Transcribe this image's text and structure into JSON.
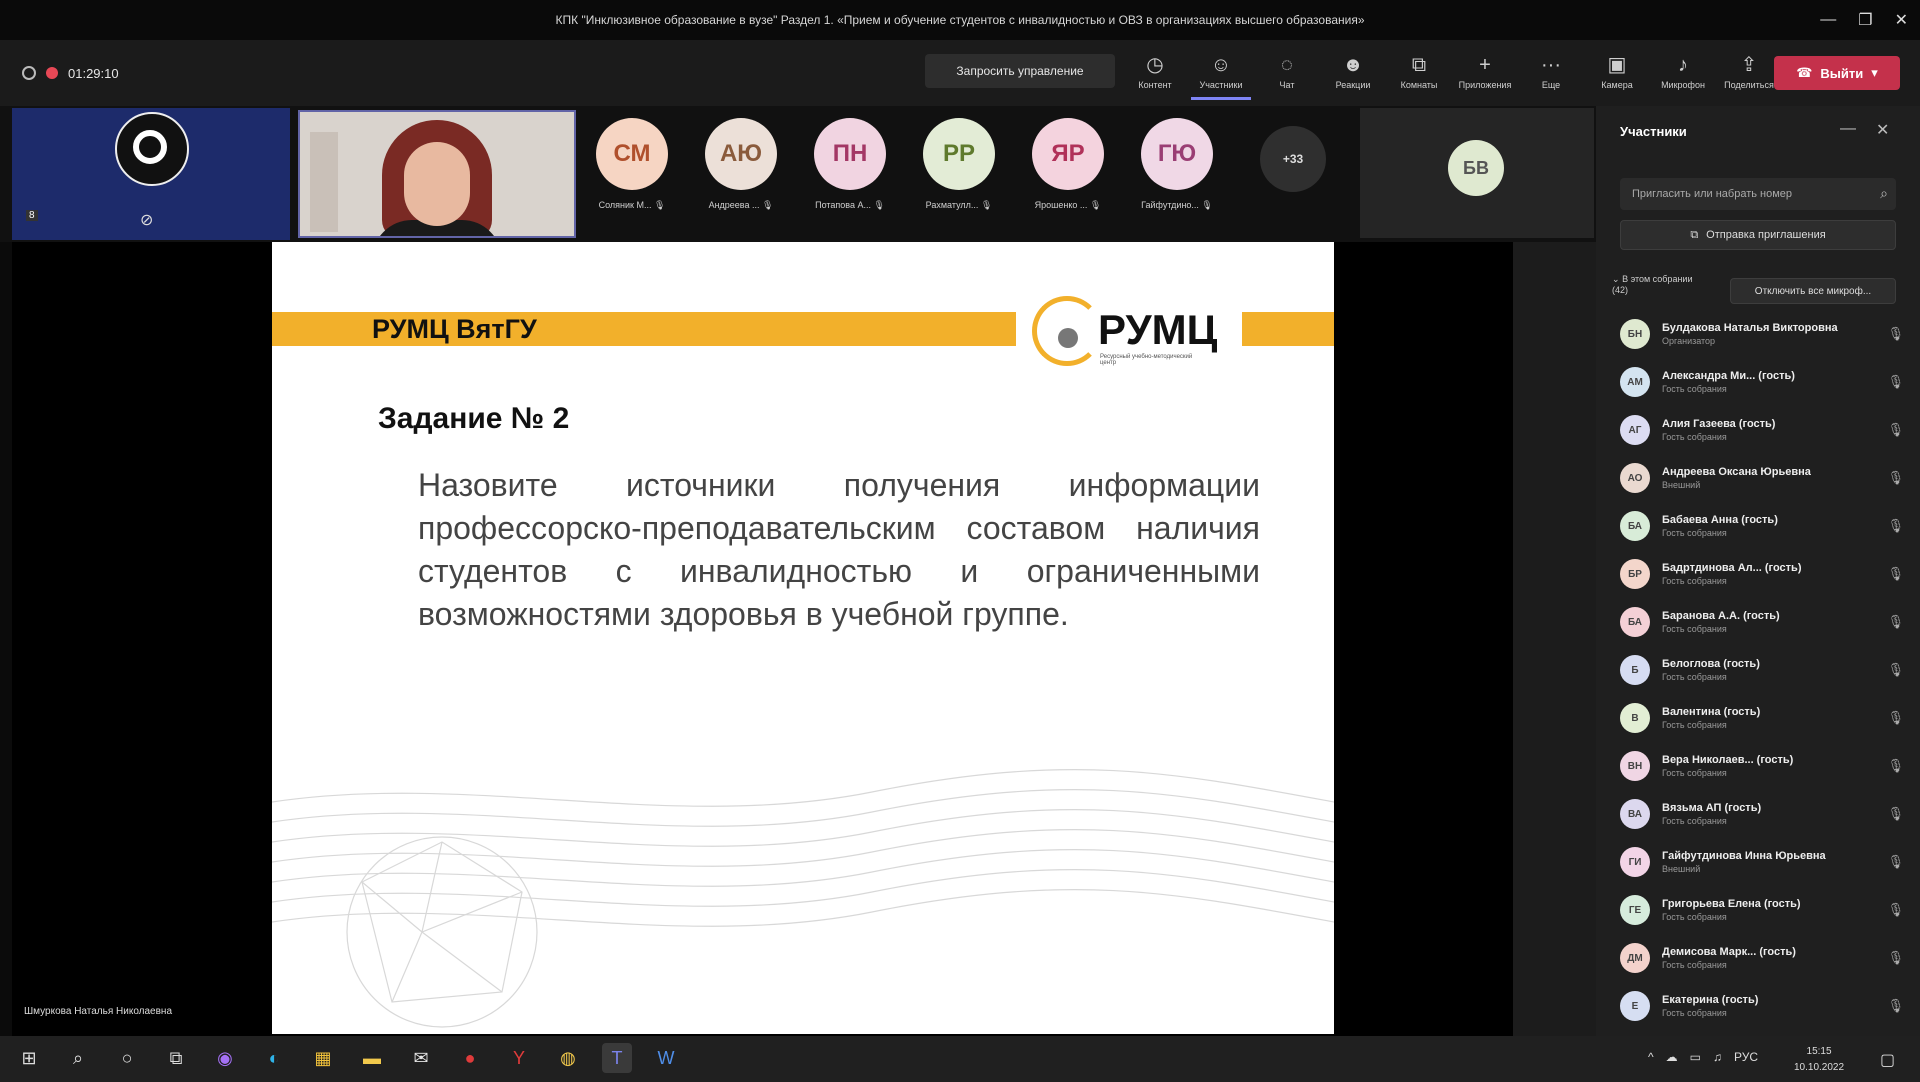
{
  "window": {
    "title": "КПК \"Инклюзивное образование в вузе\" Раздел 1. «Прием и обучение студентов с инвалидностью и ОВЗ в организациях высшего образования»",
    "controls": [
      "—",
      "❐",
      "✕"
    ]
  },
  "toolbar": {
    "timer": "01:29:10",
    "request_control": "Запросить управление",
    "buttons": [
      {
        "label": "Контент",
        "icon": "◷"
      },
      {
        "label": "Участники",
        "icon": "☺"
      },
      {
        "label": "Чат",
        "icon": "◌"
      },
      {
        "label": "Реакции",
        "icon": "☻"
      },
      {
        "label": "Комнаты",
        "icon": "⧉"
      },
      {
        "label": "Приложения",
        "icon": "+"
      },
      {
        "label": "Еще",
        "icon": "···"
      },
      {
        "label": "Камера",
        "icon": "▣"
      },
      {
        "label": "Микрофон",
        "icon": "♪"
      },
      {
        "label": "Поделиться",
        "icon": "⇪"
      }
    ],
    "leave_label": "Выйти",
    "leave_icon": "☎"
  },
  "strip": {
    "mini_badge": "8",
    "avatars": [
      {
        "initials": "СМ",
        "name": "Соляник М... 🎙",
        "bg": "#f6d5c3",
        "fg": "#b0502c"
      },
      {
        "initials": "АЮ",
        "name": "Андреева ... 🎙",
        "bg": "#ece0d8",
        "fg": "#8a5b3c"
      },
      {
        "initials": "ПН",
        "name": "Потапова А... 🎙",
        "bg": "#f1d4e1",
        "fg": "#a33765"
      },
      {
        "initials": "РР",
        "name": "Рахматулл... 🎙",
        "bg": "#e3ecd6",
        "fg": "#5f7a2d"
      },
      {
        "initials": "ЯР",
        "name": "Ярошенко ... 🎙",
        "bg": "#f4d3de",
        "fg": "#b03159"
      },
      {
        "initials": "ГЮ",
        "name": "Гайфутдино... 🎙",
        "bg": "#f0d8e6",
        "fg": "#9a3e74"
      }
    ],
    "more_count": "+33",
    "bv_initials": "БВ"
  },
  "slide": {
    "org": "РУМЦ ВятГУ",
    "logo_text": "РУМЦ",
    "logo_sub": "Ресурсный учебно-методический центр",
    "task_title": "Задание № 2",
    "task_body": "Назовите источники получения информации профессорско-преподавательским составом наличия студентов с инвалидностью и ограниченными возможностями здоровья в учебной группе."
  },
  "speaker_label": "Шмуркова Наталья Николаевна",
  "panel": {
    "title": "Участники",
    "invite_placeholder": "Пригласить или набрать номер",
    "share_invite": "Отправка приглашения",
    "section_label": "В этом собрании (42)",
    "mute_all": "Отключить все микроф...",
    "participants": [
      {
        "initials": "БН",
        "name": "Булдакова Наталья Викторовна",
        "role": "Организатор",
        "bg": "#dfe9d0"
      },
      {
        "initials": "АМ",
        "name": "Александра Ми... (гость)",
        "role": "Гость собрания",
        "bg": "#d4e4f0"
      },
      {
        "initials": "АГ",
        "name": "Алия Газеева (гость)",
        "role": "Гость собрания",
        "bg": "#dcdcf2"
      },
      {
        "initials": "АО",
        "name": "Андреева Оксана Юрьевна",
        "role": "Внешний",
        "bg": "#ead9d0"
      },
      {
        "initials": "БА",
        "name": "Бабаева Анна (гость)",
        "role": "Гость собрания",
        "bg": "#d8ecd8"
      },
      {
        "initials": "БР",
        "name": "Бадртдинова Ал... (гость)",
        "role": "Гость собрания",
        "bg": "#f3d6cb"
      },
      {
        "initials": "БА",
        "name": "Баранова А.А. (гость)",
        "role": "Гость собрания",
        "bg": "#f4d0d6"
      },
      {
        "initials": "Б",
        "name": "Белоглова (гость)",
        "role": "Гость собрания",
        "bg": "#d6dcf2"
      },
      {
        "initials": "В",
        "name": "Валентина (гость)",
        "role": "Гость собрания",
        "bg": "#e2eed4"
      },
      {
        "initials": "ВН",
        "name": "Вера Николаев... (гость)",
        "role": "Гость собрания",
        "bg": "#f0d6e4"
      },
      {
        "initials": "ВА",
        "name": "Вязьма АП (гость)",
        "role": "Гость собрания",
        "bg": "#dcd8ee"
      },
      {
        "initials": "ГИ",
        "name": "Гайфутдинова Инна Юрьевна",
        "role": "Внешний",
        "bg": "#f2d4e6"
      },
      {
        "initials": "ГЕ",
        "name": "Григорьева Елена (гость)",
        "role": "Гость собрания",
        "bg": "#d6ecdc"
      },
      {
        "initials": "ДМ",
        "name": "Демисова Марк... (гость)",
        "role": "Гость собрания",
        "bg": "#f3d2cc"
      },
      {
        "initials": "Е",
        "name": "Екатерина (гость)",
        "role": "Гость собрания",
        "bg": "#d6def2"
      }
    ]
  },
  "taskbar": {
    "icons": [
      {
        "name": "start",
        "glyph": "⊞"
      },
      {
        "name": "search",
        "glyph": "⌕"
      },
      {
        "name": "cortana",
        "glyph": "○"
      },
      {
        "name": "task-view",
        "glyph": "⧉"
      },
      {
        "name": "app-purple",
        "glyph": "◉",
        "color": "#a470f5"
      },
      {
        "name": "edge",
        "glyph": "◐",
        "color": "#2fb3e8"
      },
      {
        "name": "store",
        "glyph": "▦",
        "color": "#f0c13a"
      },
      {
        "name": "files",
        "glyph": "▬",
        "color": "#f2c94c"
      },
      {
        "name": "mail",
        "glyph": "✉",
        "color": "#e6e6e6"
      },
      {
        "name": "app-red",
        "glyph": "●",
        "color": "#e03b3b"
      },
      {
        "name": "yandex",
        "glyph": "Y",
        "color": "#e03b3b"
      },
      {
        "name": "chrome",
        "glyph": "◍",
        "color": "#f2c94c"
      },
      {
        "name": "teams",
        "glyph": "T",
        "color": "#7b83eb",
        "active": true
      },
      {
        "name": "word",
        "glyph": "W",
        "color": "#4f8ee8"
      }
    ],
    "tray": [
      "^",
      "☁",
      "▭",
      "♫",
      "РУС"
    ],
    "time": "15:15",
    "date": "10.10.2022",
    "notifications_icon": "▢"
  },
  "colors": {
    "accent": "#6264a7",
    "leave": "#c4314b",
    "slide_band": "#f2b02b"
  }
}
